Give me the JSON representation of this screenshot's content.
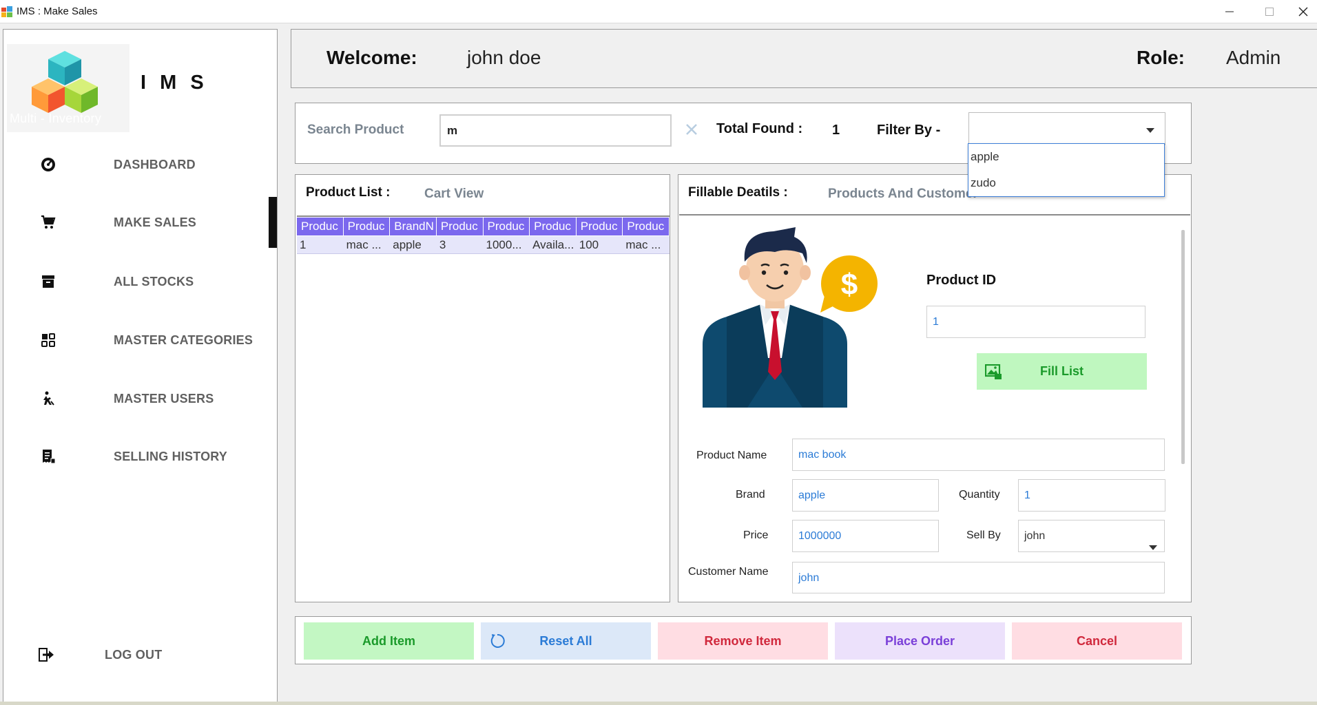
{
  "window": {
    "title": "IMS : Make Sales"
  },
  "sidebar": {
    "app_name": "I M S",
    "logo_caption": "Multi - Inventory",
    "items": [
      {
        "label": "DASHBOARD",
        "icon": "dashboard-gauge-icon"
      },
      {
        "label": "MAKE SALES",
        "icon": "cart-icon"
      },
      {
        "label": "ALL STOCKS",
        "icon": "archive-icon"
      },
      {
        "label": "MASTER CATEGORIES",
        "icon": "grid-categories-icon"
      },
      {
        "label": "MASTER USERS",
        "icon": "user-admin-icon"
      },
      {
        "label": "SELLING HISTORY",
        "icon": "receipt-icon"
      }
    ],
    "active_item": "MAKE SALES",
    "logout_label": "LOG OUT"
  },
  "header": {
    "welcome_label": "Welcome:",
    "user_name": "john doe",
    "role_label": "Role:",
    "role_value": "Admin"
  },
  "search": {
    "label": "Search Product",
    "value": "m",
    "total_found_label": "Total Found :",
    "total_found_value": "1",
    "filter_label": "Filter By -",
    "filter_value": "",
    "filter_options": [
      "apple",
      "zudo"
    ]
  },
  "product_list": {
    "title": "Product List :",
    "cart_view_label": "Cart View",
    "columns": [
      "Produc",
      "Produc",
      "BrandN",
      "Produc",
      "Produc",
      "Produc",
      "Produc",
      "Produc"
    ],
    "rows": [
      [
        "1",
        "mac ...",
        "apple",
        "3",
        "1000...",
        "Availa...",
        "100",
        "mac ..."
      ]
    ]
  },
  "fillable": {
    "title": "Fillable Deatils :",
    "tab_label": "Products And Customer",
    "product_id_label": "Product ID",
    "product_id_value": "1",
    "fill_list_label": "Fill List",
    "product_name_label": "Product Name",
    "product_name_value": "mac book",
    "brand_label": "Brand",
    "brand_value": "apple",
    "quantity_label": "Quantity",
    "quantity_value": "1",
    "price_label": "Price",
    "price_value": "1000000",
    "sell_by_label": "Sell By",
    "sell_by_value": "john",
    "customer_name_label": "Customer Name",
    "customer_name_value": "john"
  },
  "actions": {
    "add_item": "Add Item",
    "reset_all": "Reset All",
    "remove_item": "Remove Item",
    "place_order": "Place Order",
    "cancel": "Cancel"
  },
  "colors": {
    "grid_header": "#7b68ee",
    "grid_row": "#e6e6fa",
    "add_item_bg": "#c3f7c3",
    "reset_bg": "#dce8f8",
    "remove_bg": "#ffdde3",
    "place_order_bg": "#ece1fb",
    "cancel_bg": "#ffdde3",
    "fill_list_bg": "#bff7bf"
  }
}
